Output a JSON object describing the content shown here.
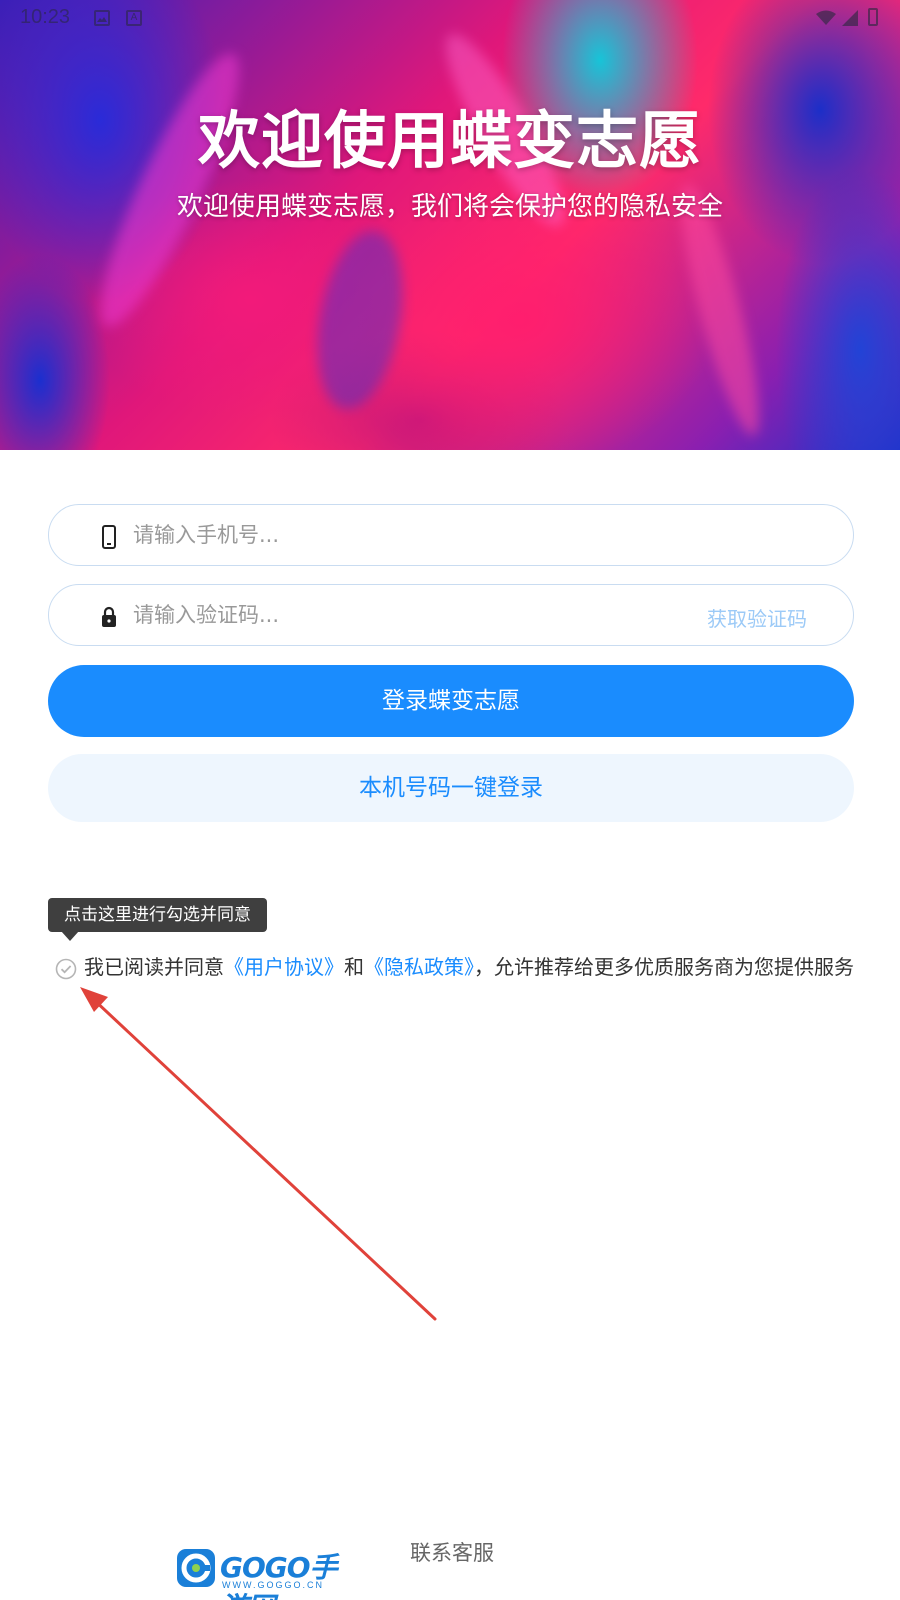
{
  "status_bar": {
    "time": "10:23",
    "icons": [
      "image-icon",
      "keyboard-a-icon",
      "wifi-icon",
      "signal-icon",
      "battery-icon"
    ],
    "keyboard_letter": "A"
  },
  "hero": {
    "title": "欢迎使用蝶变志愿",
    "subtitle": "欢迎使用蝶变志愿，我们将会保护您的隐私安全"
  },
  "form": {
    "phone_placeholder": "请输入手机号...",
    "code_placeholder": "请输入验证码...",
    "get_code_label": "获取验证码",
    "login_label": "登录蝶变志愿",
    "quick_login_label": "本机号码一键登录"
  },
  "agreement": {
    "tooltip": "点击这里进行勾选并同意",
    "prefix": "我已阅读并同意",
    "user_agreement": "《用户协议》",
    "and": "和",
    "privacy_policy": "《隐私政策》",
    "suffix": "，允许推荐给更多优质服务商为您提供服务",
    "checked": false
  },
  "footer": {
    "logo_text": "GOGO手游网",
    "logo_sub": "WWW.GOGGO.CN",
    "contact_label": "联系客服"
  },
  "colors": {
    "accent": "#1a8cfe",
    "quick_login_bg": "#eef6fe",
    "tooltip_bg": "#3f3f3f",
    "annotation_arrow": "#e0423a"
  }
}
